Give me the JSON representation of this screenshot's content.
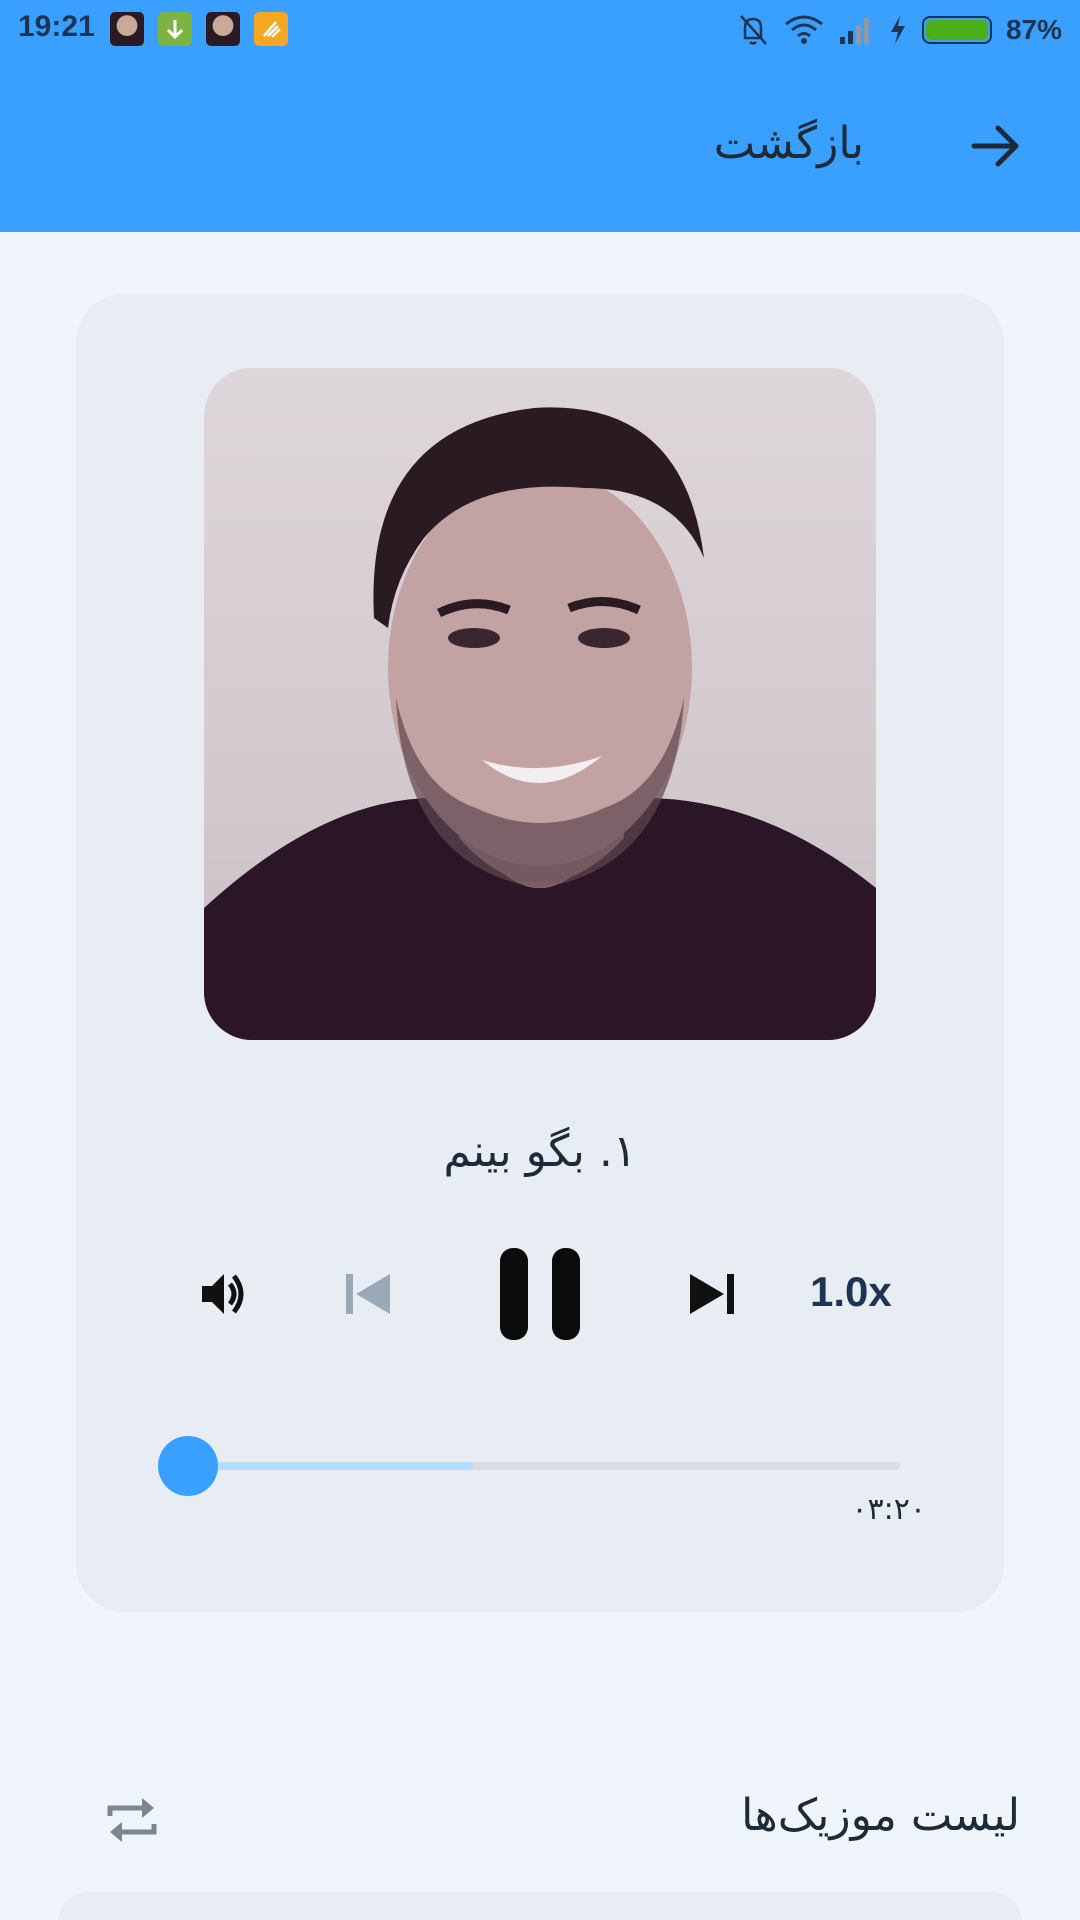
{
  "status_bar": {
    "time": "19:21",
    "battery_percent": "87%",
    "battery_level": 0.87,
    "notification_icons": [
      "avatar-icon",
      "download-icon",
      "avatar-icon",
      "clean-icon"
    ],
    "system_icons": [
      "bell-off-icon",
      "wifi-icon",
      "signal-icon",
      "charging-icon",
      "battery-icon"
    ]
  },
  "app_bar": {
    "back_label": "بازگشت",
    "back_icon": "arrow-right-icon",
    "color": "#3aa0ff"
  },
  "player": {
    "track_title": "۱. بگو بینم",
    "speed": "1.0x",
    "remaining_time": "۰۳:۲۰",
    "progress": 0.0,
    "buffered": 0.4,
    "icons": {
      "volume": "volume-icon",
      "previous": "skip-previous-icon",
      "play_pause": "pause-icon",
      "next": "skip-next-icon"
    },
    "previous_enabled": false
  },
  "playlist": {
    "title": "لیست موزیک‌ها",
    "repeat_icon": "repeat-icon"
  },
  "colors": {
    "accent": "#3aa0ff",
    "background": "#f0f5fc",
    "card": "#e8edf4",
    "text": "#1d2a38"
  }
}
